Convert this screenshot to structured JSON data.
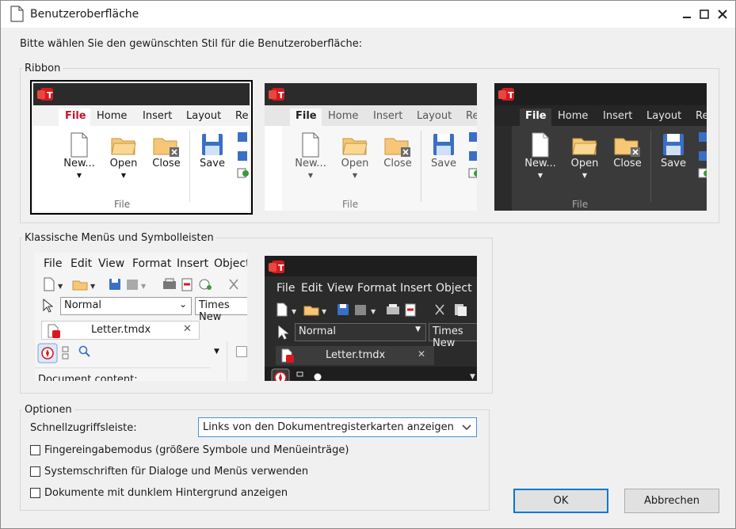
{
  "window": {
    "title": "Benutzeroberfläche",
    "icon": "document-icon",
    "controls": [
      "minimize-icon",
      "maximize-icon",
      "close-icon"
    ]
  },
  "intro": "Bitte wählen Sie den gewünschten Stil für die Benutzeroberfläche:",
  "ribbon": {
    "label": "Ribbon",
    "tabs": [
      "File",
      "Home",
      "Insert",
      "Layout",
      "Re"
    ],
    "buttons": [
      "New...",
      "Open",
      "Close",
      "Save"
    ],
    "group_label": "File",
    "styles": [
      "light-selected",
      "light-gray",
      "dark"
    ]
  },
  "classic": {
    "label": "Klassische Menüs und Symbolleisten",
    "menu": [
      "File",
      "Edit",
      "View",
      "Format",
      "Insert",
      "Object"
    ],
    "style_combo": "Normal",
    "font_combo": "Times New",
    "doc_tab": "Letter.tmdx",
    "content_hint": "Document content:"
  },
  "options": {
    "label": "Optionen",
    "quick_access_label": "Schnellzugriffsleiste:",
    "quick_access_value": "Links von den Dokumentregisterkarten anzeigen",
    "checkboxes": [
      {
        "label": "Fingereingabemodus (größere Symbole und Menüeinträge)",
        "checked": false
      },
      {
        "label": "Systemschriften für Dialoge und Menüs verwenden",
        "checked": false
      },
      {
        "label": "Dokumente mit dunklem Hintergrund anzeigen",
        "checked": false
      }
    ]
  },
  "buttons": {
    "ok": "OK",
    "cancel": "Abbrechen"
  },
  "colors": {
    "accent": "#0078d7",
    "brand_red": "#d7191f",
    "file_tab_red": "#c8102e",
    "folder": "#f5c777",
    "save_blue": "#3a6fc6"
  }
}
